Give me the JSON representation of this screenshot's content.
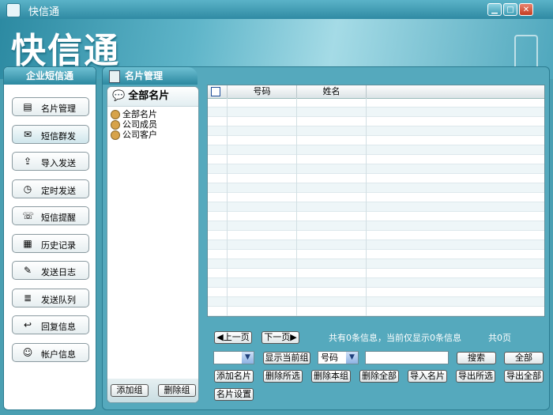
{
  "window": {
    "title": "快信通"
  },
  "banner": {
    "logo_text": "快信通"
  },
  "sidebar": {
    "header": "企业短信通",
    "items": [
      {
        "label": "名片管理",
        "icon": "card-icon"
      },
      {
        "label": "短信群发",
        "icon": "message-icon"
      },
      {
        "label": "导入发送",
        "icon": "import-icon"
      },
      {
        "label": "定时发送",
        "icon": "clock-icon"
      },
      {
        "label": "短信提醒",
        "icon": "reminder-icon"
      },
      {
        "label": "历史记录",
        "icon": "history-icon"
      },
      {
        "label": "发送日志",
        "icon": "log-icon"
      },
      {
        "label": "发送队列",
        "icon": "queue-icon"
      },
      {
        "label": "回复信息",
        "icon": "reply-icon"
      },
      {
        "label": "帐户信息",
        "icon": "account-icon"
      }
    ]
  },
  "main": {
    "tab_title": "名片管理",
    "tree": {
      "header": "全部名片",
      "items": [
        "全部名片",
        "公司成员",
        "公司客户"
      ],
      "add_group": "添加组",
      "delete_group": "删除组"
    },
    "table": {
      "columns": [
        "号码",
        "姓名"
      ],
      "rows": []
    },
    "pager": {
      "prev": "上一页",
      "next": "下一页",
      "summary": "共有0条信息，当前仅显示0条信息",
      "pages": "共0页"
    },
    "controls": {
      "group_select_value": "",
      "show_current_group": "显示当前组",
      "field_select_value": "号码",
      "search_value": "",
      "search": "搜索",
      "all": "全部",
      "add_card": "添加名片",
      "delete_selected": "删除所选",
      "delete_group": "删除本组",
      "delete_all": "删除全部",
      "import_card": "导入名片",
      "export_selected": "导出所选",
      "export_all": "导出全部",
      "card_settings": "名片设置"
    }
  },
  "colors": {
    "accent": "#2b88a0",
    "background": "#4a9fb2"
  }
}
